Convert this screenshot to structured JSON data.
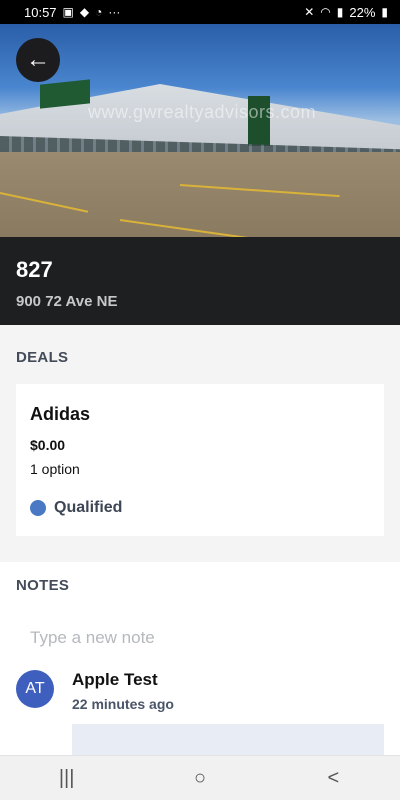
{
  "status_bar": {
    "time": "10:57",
    "left_icons": [
      "image-icon",
      "bag-icon",
      "timer-icon",
      "more-icon"
    ],
    "right_icons": [
      "mute-icon",
      "wifi-icon",
      "signal-icon"
    ],
    "battery": "22%"
  },
  "hero": {
    "watermark": "www.gwrealtyadvisors.com"
  },
  "property": {
    "title": "827",
    "address": "900 72 Ave NE"
  },
  "deals": {
    "section_title": "DEALS",
    "items": [
      {
        "name": "Adidas",
        "amount": "$0.00",
        "options": "1 option",
        "status": "Qualified",
        "status_color": "#4a78c4"
      }
    ]
  },
  "notes": {
    "section_title": "NOTES",
    "input_placeholder": "Type a new note",
    "items": [
      {
        "initials": "AT",
        "author": "Apple Test",
        "time": "22 minutes ago",
        "avatar_color": "#3f5fbf"
      }
    ]
  },
  "nav": {
    "recents": "|||",
    "home": "○",
    "back": "<"
  }
}
